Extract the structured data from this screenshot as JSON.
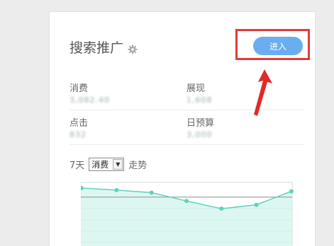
{
  "header": {
    "title": "搜索推广",
    "gear_icon": "gear-icon"
  },
  "enter_button": {
    "label": "进入",
    "color": "#6aaef0",
    "highlight_color": "#e23b3b"
  },
  "stats": [
    {
      "label": "消费",
      "value": "3,082.40"
    },
    {
      "label": "展现",
      "value": "1,608"
    },
    {
      "label": "点击",
      "value": "832"
    },
    {
      "label": "日预算",
      "value": "3,000"
    }
  ],
  "trend": {
    "days_label": "7天",
    "metric_select": "消费",
    "suffix": "走势"
  },
  "chart_data": {
    "type": "area",
    "x": [
      1,
      2,
      3,
      4,
      5,
      6,
      7
    ],
    "series": [
      {
        "values": [
          100,
          97,
          93,
          80,
          68,
          74,
          95
        ]
      }
    ],
    "reference_line": 86,
    "ylim": [
      0,
      110
    ],
    "line_color": "#5fd3bd",
    "fill_color": "#dcf7f1",
    "reference_color": "#9a9a9a"
  }
}
